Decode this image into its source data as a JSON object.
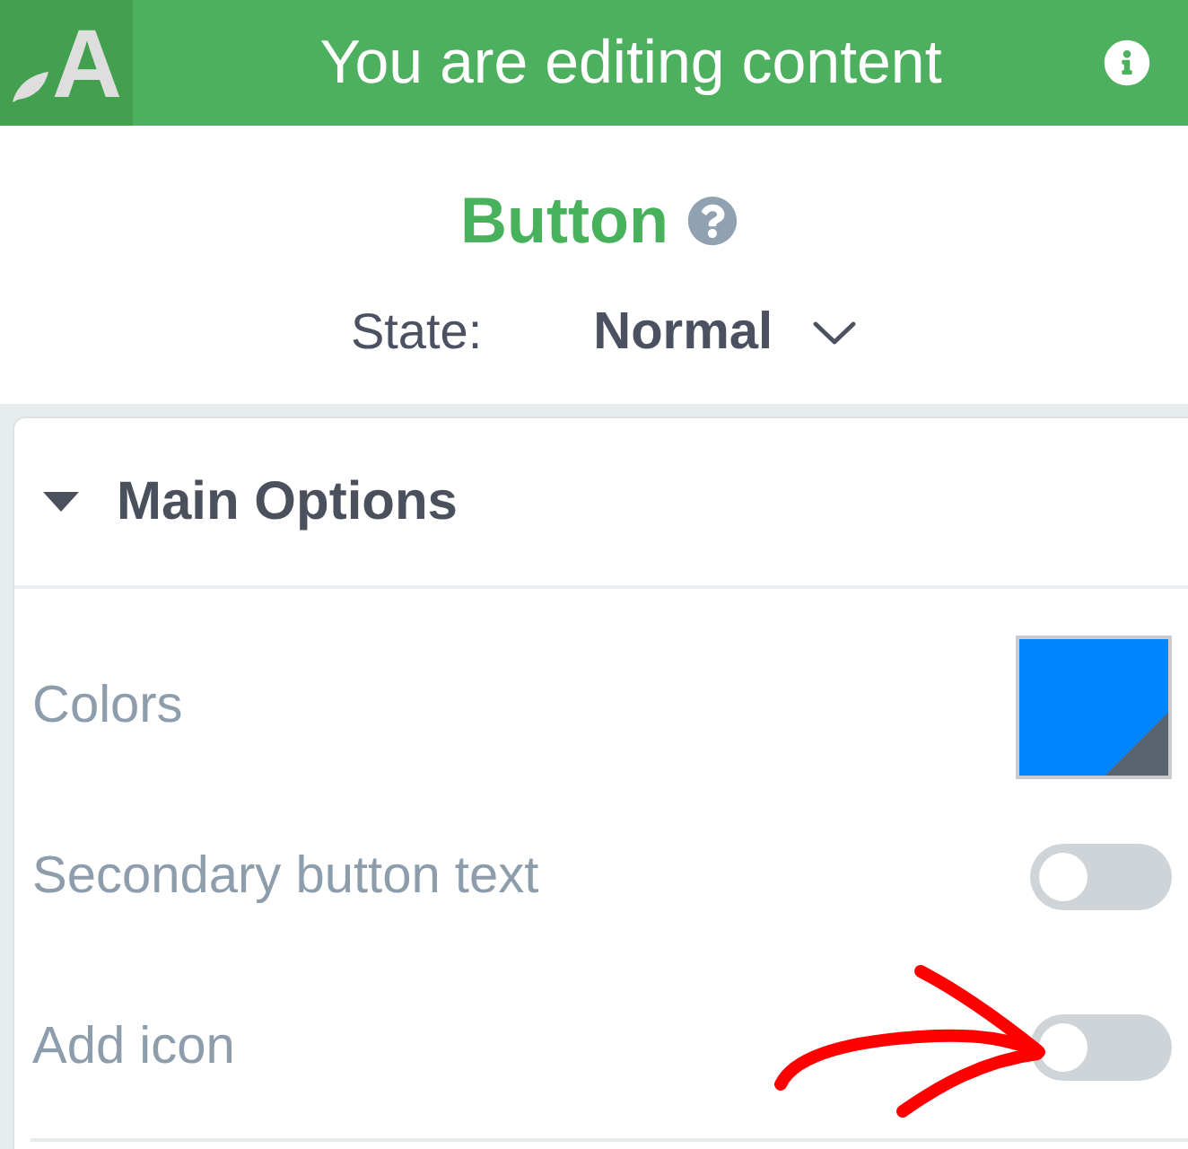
{
  "header": {
    "logo_letter": "A",
    "title": "You are editing content"
  },
  "element": {
    "title": "Button",
    "state_label": "State:",
    "state_value": "Normal"
  },
  "section": {
    "title": "Main Options",
    "expanded": true,
    "options": [
      {
        "kind": "color",
        "label": "Colors",
        "color": "#0084ff"
      },
      {
        "kind": "toggle",
        "label": "Secondary button text",
        "on": false
      },
      {
        "kind": "toggle",
        "label": "Add icon",
        "on": false
      }
    ]
  }
}
